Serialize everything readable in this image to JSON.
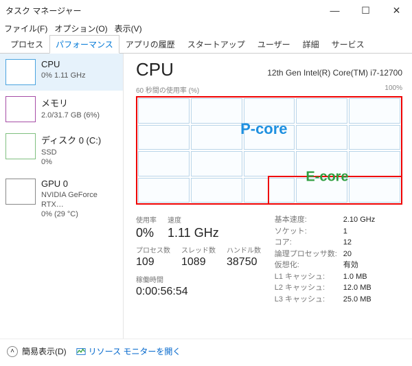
{
  "window": {
    "title": "タスク マネージャー"
  },
  "menu": {
    "file": "ファイル(F)",
    "options": "オプション(O)",
    "view": "表示(V)"
  },
  "tabs": {
    "processes": "プロセス",
    "performance": "パフォーマンス",
    "app_history": "アプリの履歴",
    "startup": "スタートアップ",
    "users": "ユーザー",
    "details": "詳細",
    "services": "サービス"
  },
  "sidebar": {
    "cpu": {
      "title": "CPU",
      "sub": "0%  1.11 GHz"
    },
    "mem": {
      "title": "メモリ",
      "sub": "2.0/31.7 GB (6%)"
    },
    "disk": {
      "title": "ディスク 0 (C:)",
      "sub": "SSD\n0%"
    },
    "gpu": {
      "title": "GPU 0",
      "sub": "NVIDIA GeForce RTX…\n0%  (29 °C)"
    }
  },
  "main": {
    "heading": "CPU",
    "cpu_name": "12th Gen Intel(R) Core(TM) i7-12700",
    "chart_caption_left": "60 秒間の使用率 (%)",
    "chart_caption_right": "100%",
    "overlay_pcore": "P-core",
    "overlay_ecore": "E-core"
  },
  "stats": {
    "util_label": "使用率",
    "util_value": "0%",
    "speed_label": "速度",
    "speed_value": "1.11 GHz",
    "proc_label": "プロセス数",
    "proc_value": "109",
    "threads_label": "スレッド数",
    "threads_value": "1089",
    "handles_label": "ハンドル数",
    "handles_value": "38750",
    "uptime_label": "稼働時間",
    "uptime_value": "0:00:56:54"
  },
  "specs": {
    "base_speed_k": "基本速度:",
    "base_speed_v": "2.10 GHz",
    "sockets_k": "ソケット:",
    "sockets_v": "1",
    "cores_k": "コア:",
    "cores_v": "12",
    "logical_k": "論理プロセッサ数:",
    "logical_v": "20",
    "virt_k": "仮想化:",
    "virt_v": "有効",
    "l1_k": "L1 キャッシュ:",
    "l1_v": "1.0 MB",
    "l2_k": "L2 キャッシュ:",
    "l2_v": "12.0 MB",
    "l3_k": "L3 キャッシュ:",
    "l3_v": "25.0 MB"
  },
  "footer": {
    "fewer": "簡易表示(D)",
    "resmon": "リソース モニターを開く"
  },
  "chart_data": {
    "type": "grid",
    "rows": 4,
    "cols": 5,
    "note": "Per-logical-processor activity grid; 20 cells. Annotations mark top 3 rows as P-core and bottom-right block as E-core. All cells ~0% utilization.",
    "utilization_percent": 0
  }
}
